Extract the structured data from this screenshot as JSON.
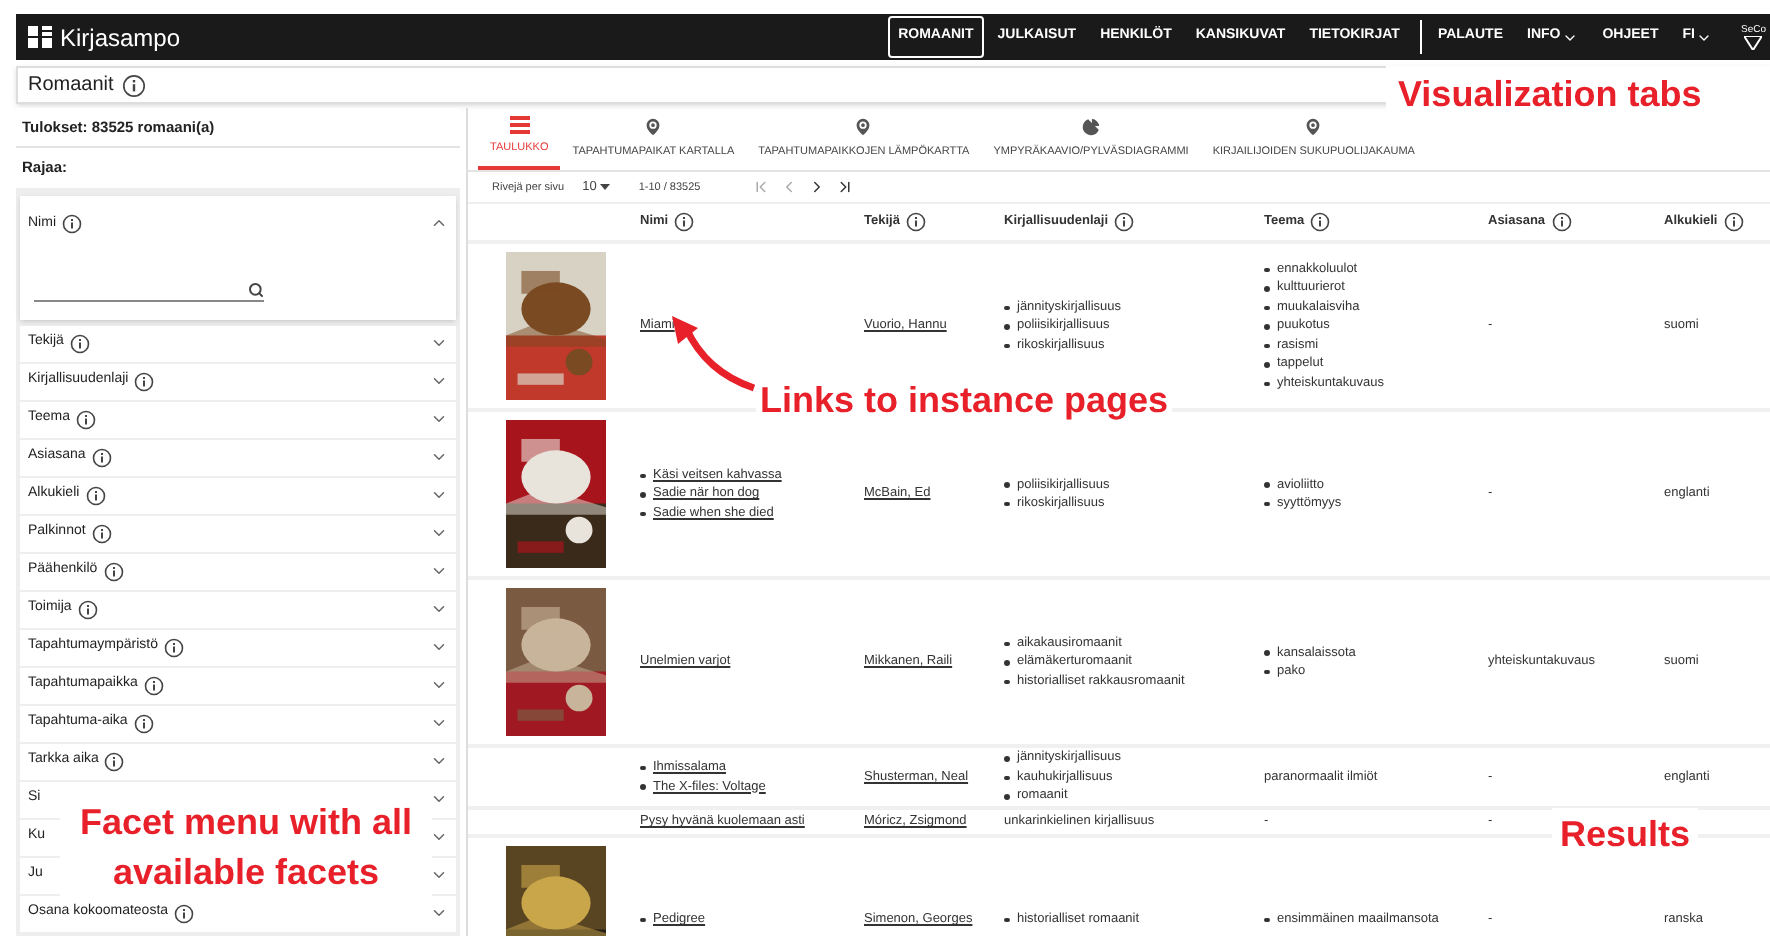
{
  "header": {
    "logo": "Kirjasampo",
    "nav": [
      {
        "label": "ROMAANIT",
        "selected": true
      },
      {
        "label": "JULKAISUT",
        "selected": false
      },
      {
        "label": "HENKILÖT",
        "selected": false
      },
      {
        "label": "KANSIKUVAT",
        "selected": false
      },
      {
        "label": "TIETOKIRJAT",
        "selected": false
      }
    ],
    "secondary_nav": [
      {
        "label": "PALAUTE",
        "dropdown": false
      },
      {
        "label": "INFO",
        "dropdown": true
      },
      {
        "label": "OHJEET",
        "dropdown": false
      },
      {
        "label": "FI",
        "dropdown": true
      }
    ],
    "partner_logo": "SeCo"
  },
  "page_title": "Romaanit",
  "results_summary": "Tulokset: 83525 romaani(a)",
  "filter_heading": "Rajaa:",
  "facets": [
    {
      "label": "Nimi",
      "info": true,
      "expanded": true
    },
    {
      "label": "Tekijä",
      "info": true,
      "expanded": false
    },
    {
      "label": "Kirjallisuudenlaji",
      "info": true,
      "expanded": false
    },
    {
      "label": "Teema",
      "info": true,
      "expanded": false
    },
    {
      "label": "Asiasana",
      "info": true,
      "expanded": false
    },
    {
      "label": "Alkukieli",
      "info": true,
      "expanded": false
    },
    {
      "label": "Palkinnot",
      "info": true,
      "expanded": false
    },
    {
      "label": "Päähenkilö",
      "info": true,
      "expanded": false
    },
    {
      "label": "Toimija",
      "info": true,
      "expanded": false
    },
    {
      "label": "Tapahtumaympäristö",
      "info": true,
      "expanded": false
    },
    {
      "label": "Tapahtumapaikka",
      "info": true,
      "expanded": false
    },
    {
      "label": "Tapahtuma-aika",
      "info": true,
      "expanded": false
    },
    {
      "label": "Tarkka aika",
      "info": true,
      "expanded": false
    },
    {
      "label": "Si",
      "info": false,
      "expanded": false
    },
    {
      "label": "Ku",
      "info": false,
      "expanded": false
    },
    {
      "label": "Ju",
      "info": false,
      "expanded": false
    },
    {
      "label": "Osana kokoomateosta",
      "info": true,
      "expanded": false
    }
  ],
  "tabs": [
    {
      "label": "TAULUKKO",
      "kind": "table",
      "selected": true
    },
    {
      "label": "TAPAHTUMAPAIKAT KARTALLA",
      "kind": "map",
      "selected": false
    },
    {
      "label": "TAPAHTUMAPAIKKOJEN LÄMPÖKARTTA",
      "kind": "map",
      "selected": false
    },
    {
      "label": "YMPYRÄKAAVIO/PYLVÄSDIAGRAMMI",
      "kind": "pie",
      "selected": false
    },
    {
      "label": "KIRJAILIJOIDEN SUKUPUOLIJAKAUMA",
      "kind": "map",
      "selected": false
    }
  ],
  "pagination": {
    "rows_per_page_label": "Rivejä per sivu",
    "rows_per_page": "10",
    "range": "1-10 / 83525"
  },
  "table": {
    "columns": [
      "Nimi",
      "Tekijä",
      "Kirjallisuudenlaji",
      "Teema",
      "Asiasana",
      "Alkukieli"
    ],
    "rows": [
      {
        "cover": true,
        "nimi": "Miami",
        "tekija": "Vuorio, Hannu",
        "laji": [
          "jännityskirjallisuus",
          "poliisikirjallisuus",
          "rikoskirjallisuus"
        ],
        "teema": [
          "ennakkoluulot",
          "kulttuurierot",
          "muukalaisviha",
          "puukotus",
          "rasismi",
          "tappelut",
          "yhteiskuntakuvaus"
        ],
        "asiasana": "-",
        "alkukieli": "suomi"
      },
      {
        "cover": true,
        "nimi": [
          "Käsi veitsen kahvassa",
          "Sadie när hon dog",
          "Sadie when she died"
        ],
        "tekija": "McBain, Ed",
        "laji": [
          "poliisikirjallisuus",
          "rikoskirjallisuus"
        ],
        "teema": [
          "avioliitto",
          "syyttömyys"
        ],
        "asiasana": "-",
        "alkukieli": "englanti"
      },
      {
        "cover": true,
        "nimi": "Unelmien varjot",
        "tekija": "Mikkanen, Raili",
        "laji": [
          "aikakausiromaanit",
          "elämäkerturomaanit",
          "historialliset rakkausromaanit"
        ],
        "teema": [
          "kansalaissota",
          "pako"
        ],
        "asiasana": "yhteiskuntakuvaus",
        "alkukieli": "suomi"
      },
      {
        "cover": false,
        "nimi": [
          "Ihmissalama",
          "The X-files: Voltage"
        ],
        "tekija": "Shusterman, Neal",
        "laji": [
          "jännityskirjallisuus",
          "kauhukirjallisuus",
          "romaanit"
        ],
        "teema": "paranormaalit ilmiöt",
        "asiasana": "-",
        "alkukieli": "englanti"
      },
      {
        "cover": false,
        "nimi": "Pysy hyvänä kuolemaan asti",
        "tekija": "Móricz, Zsigmond",
        "laji": "unkarinkielinen kirjallisuus",
        "teema": "-",
        "asiasana": "-"
      },
      {
        "cover": true,
        "nimi": [
          "Pedigree"
        ],
        "tekija": "Simenon, Georges",
        "laji": [
          "historialliset romaanit"
        ],
        "teema": [
          "ensimmäinen maailmansota"
        ],
        "asiasana": "-",
        "alkukieli": "ranska"
      }
    ]
  },
  "annotations": [
    {
      "text": "Visualization tabs"
    },
    {
      "text": "Links to instance pages",
      "arrow": true
    },
    {
      "text": "Facet menu with all available facets"
    },
    {
      "text": "Results"
    }
  ]
}
